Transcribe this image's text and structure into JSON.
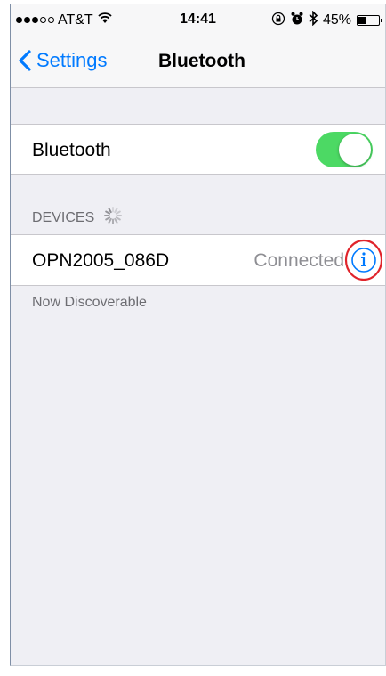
{
  "status_bar": {
    "carrier": "AT&T",
    "time": "14:41",
    "battery_percent": "45%",
    "battery_level": 0.45,
    "signal_bars_full": 3,
    "signal_bars_total": 5,
    "icons": [
      "wifi-icon",
      "rotation-lock-icon",
      "alarm-icon",
      "bluetooth-icon",
      "battery-icon"
    ]
  },
  "navbar": {
    "back_label": "Settings",
    "title": "Bluetooth"
  },
  "bluetooth_row": {
    "label": "Bluetooth",
    "enabled": true,
    "toggle_color": "#4cd964"
  },
  "devices_section": {
    "header": "DEVICES",
    "searching_indicator": "spinner-icon",
    "devices": [
      {
        "name": "OPN2005_086D",
        "status": "Connected",
        "accessory": "info-icon"
      }
    ],
    "footer": "Now Discoverable"
  },
  "colors": {
    "accent": "#007aff",
    "background": "#efeff4",
    "annotation_circle": "#e0242b"
  }
}
